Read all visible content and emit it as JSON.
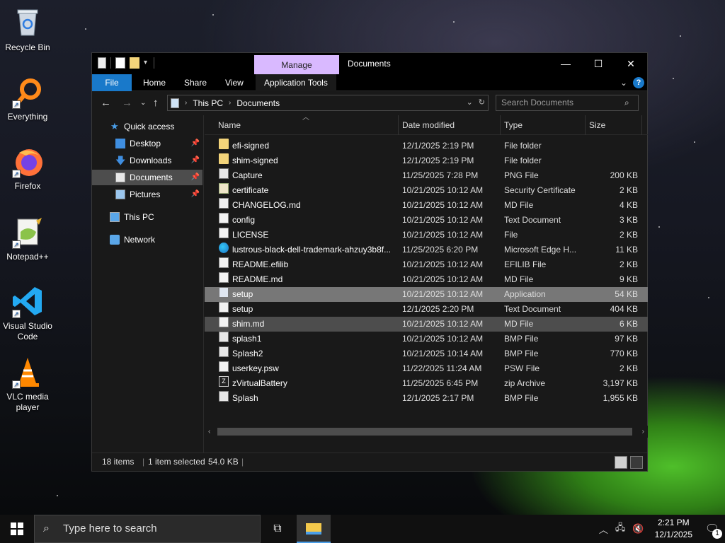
{
  "desktop": {
    "icons": [
      {
        "label": "Recycle Bin",
        "icon": "recycle-bin-icon"
      },
      {
        "label": "Everything",
        "icon": "everything-search-icon"
      },
      {
        "label": "Firefox",
        "icon": "firefox-icon"
      },
      {
        "label": "Notepad++",
        "icon": "notepad-plus-plus-icon"
      },
      {
        "label": "Visual Studio Code",
        "icon": "vscode-icon"
      },
      {
        "label": "VLC media player",
        "icon": "vlc-icon"
      }
    ]
  },
  "window": {
    "title": "Documents",
    "context_tab": "Manage",
    "controls": {
      "minimize": "—",
      "maximize": "☐",
      "close": "✕"
    },
    "ribbon_tabs": [
      "File",
      "Home",
      "Share",
      "View",
      "Application Tools"
    ],
    "address": {
      "root": "This PC",
      "current": "Documents"
    },
    "search_placeholder": "Search Documents"
  },
  "navpane": {
    "items": [
      {
        "label": "Quick access",
        "pinned": false
      },
      {
        "label": "Desktop",
        "pinned": true
      },
      {
        "label": "Downloads",
        "pinned": true
      },
      {
        "label": "Documents",
        "pinned": true,
        "selected": true
      },
      {
        "label": "Pictures",
        "pinned": true
      },
      {
        "label": "This PC",
        "pinned": false
      },
      {
        "label": "Network",
        "pinned": false
      }
    ]
  },
  "columns": {
    "name": "Name",
    "date": "Date modified",
    "type": "Type",
    "size": "Size"
  },
  "files": [
    {
      "name": "efi-signed",
      "date": "12/1/2025 2:19 PM",
      "type": "File folder",
      "size": "",
      "icon": "folder"
    },
    {
      "name": "shim-signed",
      "date": "12/1/2025 2:19 PM",
      "type": "File folder",
      "size": "",
      "icon": "folder"
    },
    {
      "name": "Capture",
      "date": "11/25/2025 7:28 PM",
      "type": "PNG File",
      "size": "200 KB",
      "icon": "img"
    },
    {
      "name": "certificate",
      "date": "10/21/2025 10:12 AM",
      "type": "Security Certificate",
      "size": "2 KB",
      "icon": "cert"
    },
    {
      "name": "CHANGELOG.md",
      "date": "10/21/2025 10:12 AM",
      "type": "MD File",
      "size": "4 KB",
      "icon": "doc"
    },
    {
      "name": "config",
      "date": "10/21/2025 10:12 AM",
      "type": "Text Document",
      "size": "3 KB",
      "icon": "doc"
    },
    {
      "name": "LICENSE",
      "date": "10/21/2025 10:12 AM",
      "type": "File",
      "size": "2 KB",
      "icon": "doc"
    },
    {
      "name": "lustrous-black-dell-trademark-ahzuy3b8f...",
      "date": "11/25/2025 6:20 PM",
      "type": "Microsoft Edge H...",
      "size": "11 KB",
      "icon": "edge"
    },
    {
      "name": "README.efilib",
      "date": "10/21/2025 10:12 AM",
      "type": "EFILIB File",
      "size": "2 KB",
      "icon": "doc"
    },
    {
      "name": "README.md",
      "date": "10/21/2025 10:12 AM",
      "type": "MD File",
      "size": "9 KB",
      "icon": "doc"
    },
    {
      "name": "setup",
      "date": "10/21/2025 10:12 AM",
      "type": "Application",
      "size": "54 KB",
      "icon": "app",
      "state": "selected"
    },
    {
      "name": "setup",
      "date": "12/1/2025 2:20 PM",
      "type": "Text Document",
      "size": "404 KB",
      "icon": "doc"
    },
    {
      "name": "shim.md",
      "date": "10/21/2025 10:12 AM",
      "type": "MD File",
      "size": "6 KB",
      "icon": "doc",
      "state": "hover"
    },
    {
      "name": "splash1",
      "date": "10/21/2025 10:12 AM",
      "type": "BMP File",
      "size": "97 KB",
      "icon": "img"
    },
    {
      "name": "Splash2",
      "date": "10/21/2025 10:14 AM",
      "type": "BMP File",
      "size": "770 KB",
      "icon": "img"
    },
    {
      "name": "userkey.psw",
      "date": "11/22/2025 11:24 AM",
      "type": "PSW File",
      "size": "2 KB",
      "icon": "doc"
    },
    {
      "name": "zVirtualBattery",
      "date": "11/25/2025 6:45 PM",
      "type": "zip Archive",
      "size": "3,197 KB",
      "icon": "zip"
    },
    {
      "name": "Splash",
      "date": "12/1/2025 2:17 PM",
      "type": "BMP File",
      "size": "1,955 KB",
      "icon": "img"
    }
  ],
  "status": {
    "count": "18 items",
    "selected": "1 item selected",
    "size": "54.0 KB"
  },
  "taskbar": {
    "search_placeholder": "Type here to search",
    "time": "2:21 PM",
    "date": "12/1/2025",
    "notifications": "1"
  }
}
